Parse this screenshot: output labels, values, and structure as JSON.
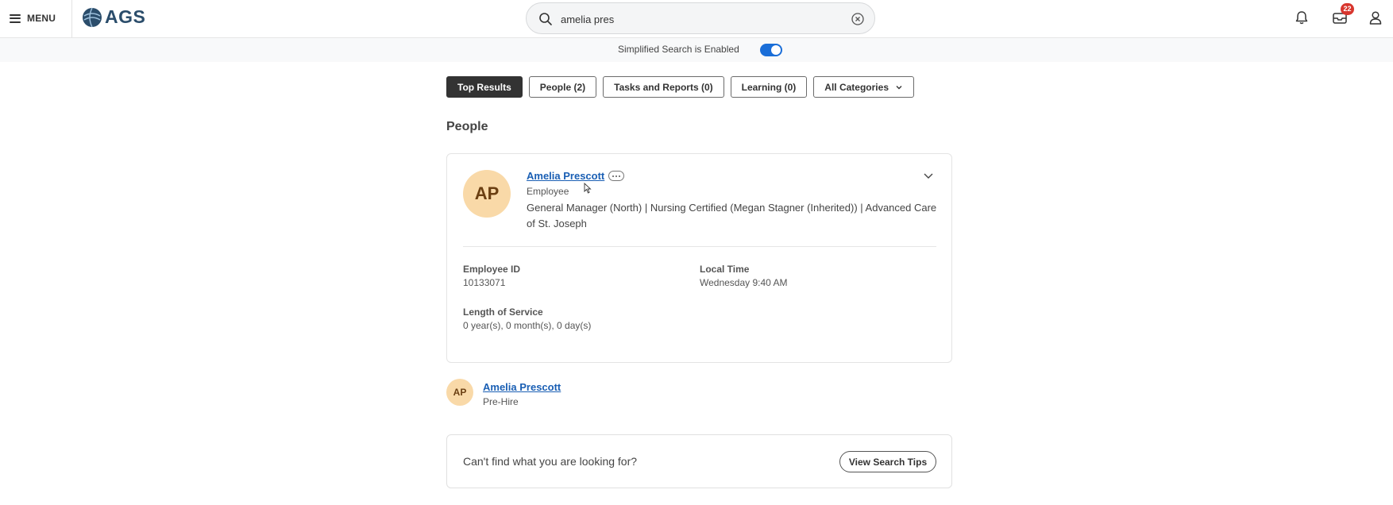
{
  "header": {
    "menu_label": "MENU",
    "logo_text": "AGS",
    "search": {
      "value": "amelia pres"
    },
    "notification_count": "22"
  },
  "simplified_search": {
    "label": "Simplified Search is Enabled",
    "enabled": true
  },
  "filters": [
    {
      "label": "Top Results",
      "active": true
    },
    {
      "label": "People (2)",
      "active": false
    },
    {
      "label": "Tasks and Reports (0)",
      "active": false
    },
    {
      "label": "Learning (0)",
      "active": false
    },
    {
      "label": "All Categories",
      "active": false,
      "has_dropdown": true
    }
  ],
  "section_title": "People",
  "person_card": {
    "initials": "AP",
    "name": "Amelia Prescott",
    "role": "Employee",
    "description": "General Manager (North) | Nursing Certified (Megan Stagner (Inherited)) | Advanced Care of St. Joseph",
    "fields": {
      "employee_id_label": "Employee ID",
      "employee_id_value": "10133071",
      "local_time_label": "Local Time",
      "local_time_value": "Wednesday 9:40 AM",
      "service_label": "Length of Service",
      "service_value": "0 year(s), 0 month(s), 0 day(s)"
    }
  },
  "second_person": {
    "initials": "AP",
    "name": "Amelia Prescott",
    "role": "Pre-Hire"
  },
  "tips": {
    "text": "Can't find what you are looking for?",
    "button_label": "View Search Tips"
  },
  "colors": {
    "accent": "#1a6ed8",
    "link": "#1a5fb4",
    "badge": "#d8362e",
    "avatar_bg": "#f9d9a8"
  }
}
